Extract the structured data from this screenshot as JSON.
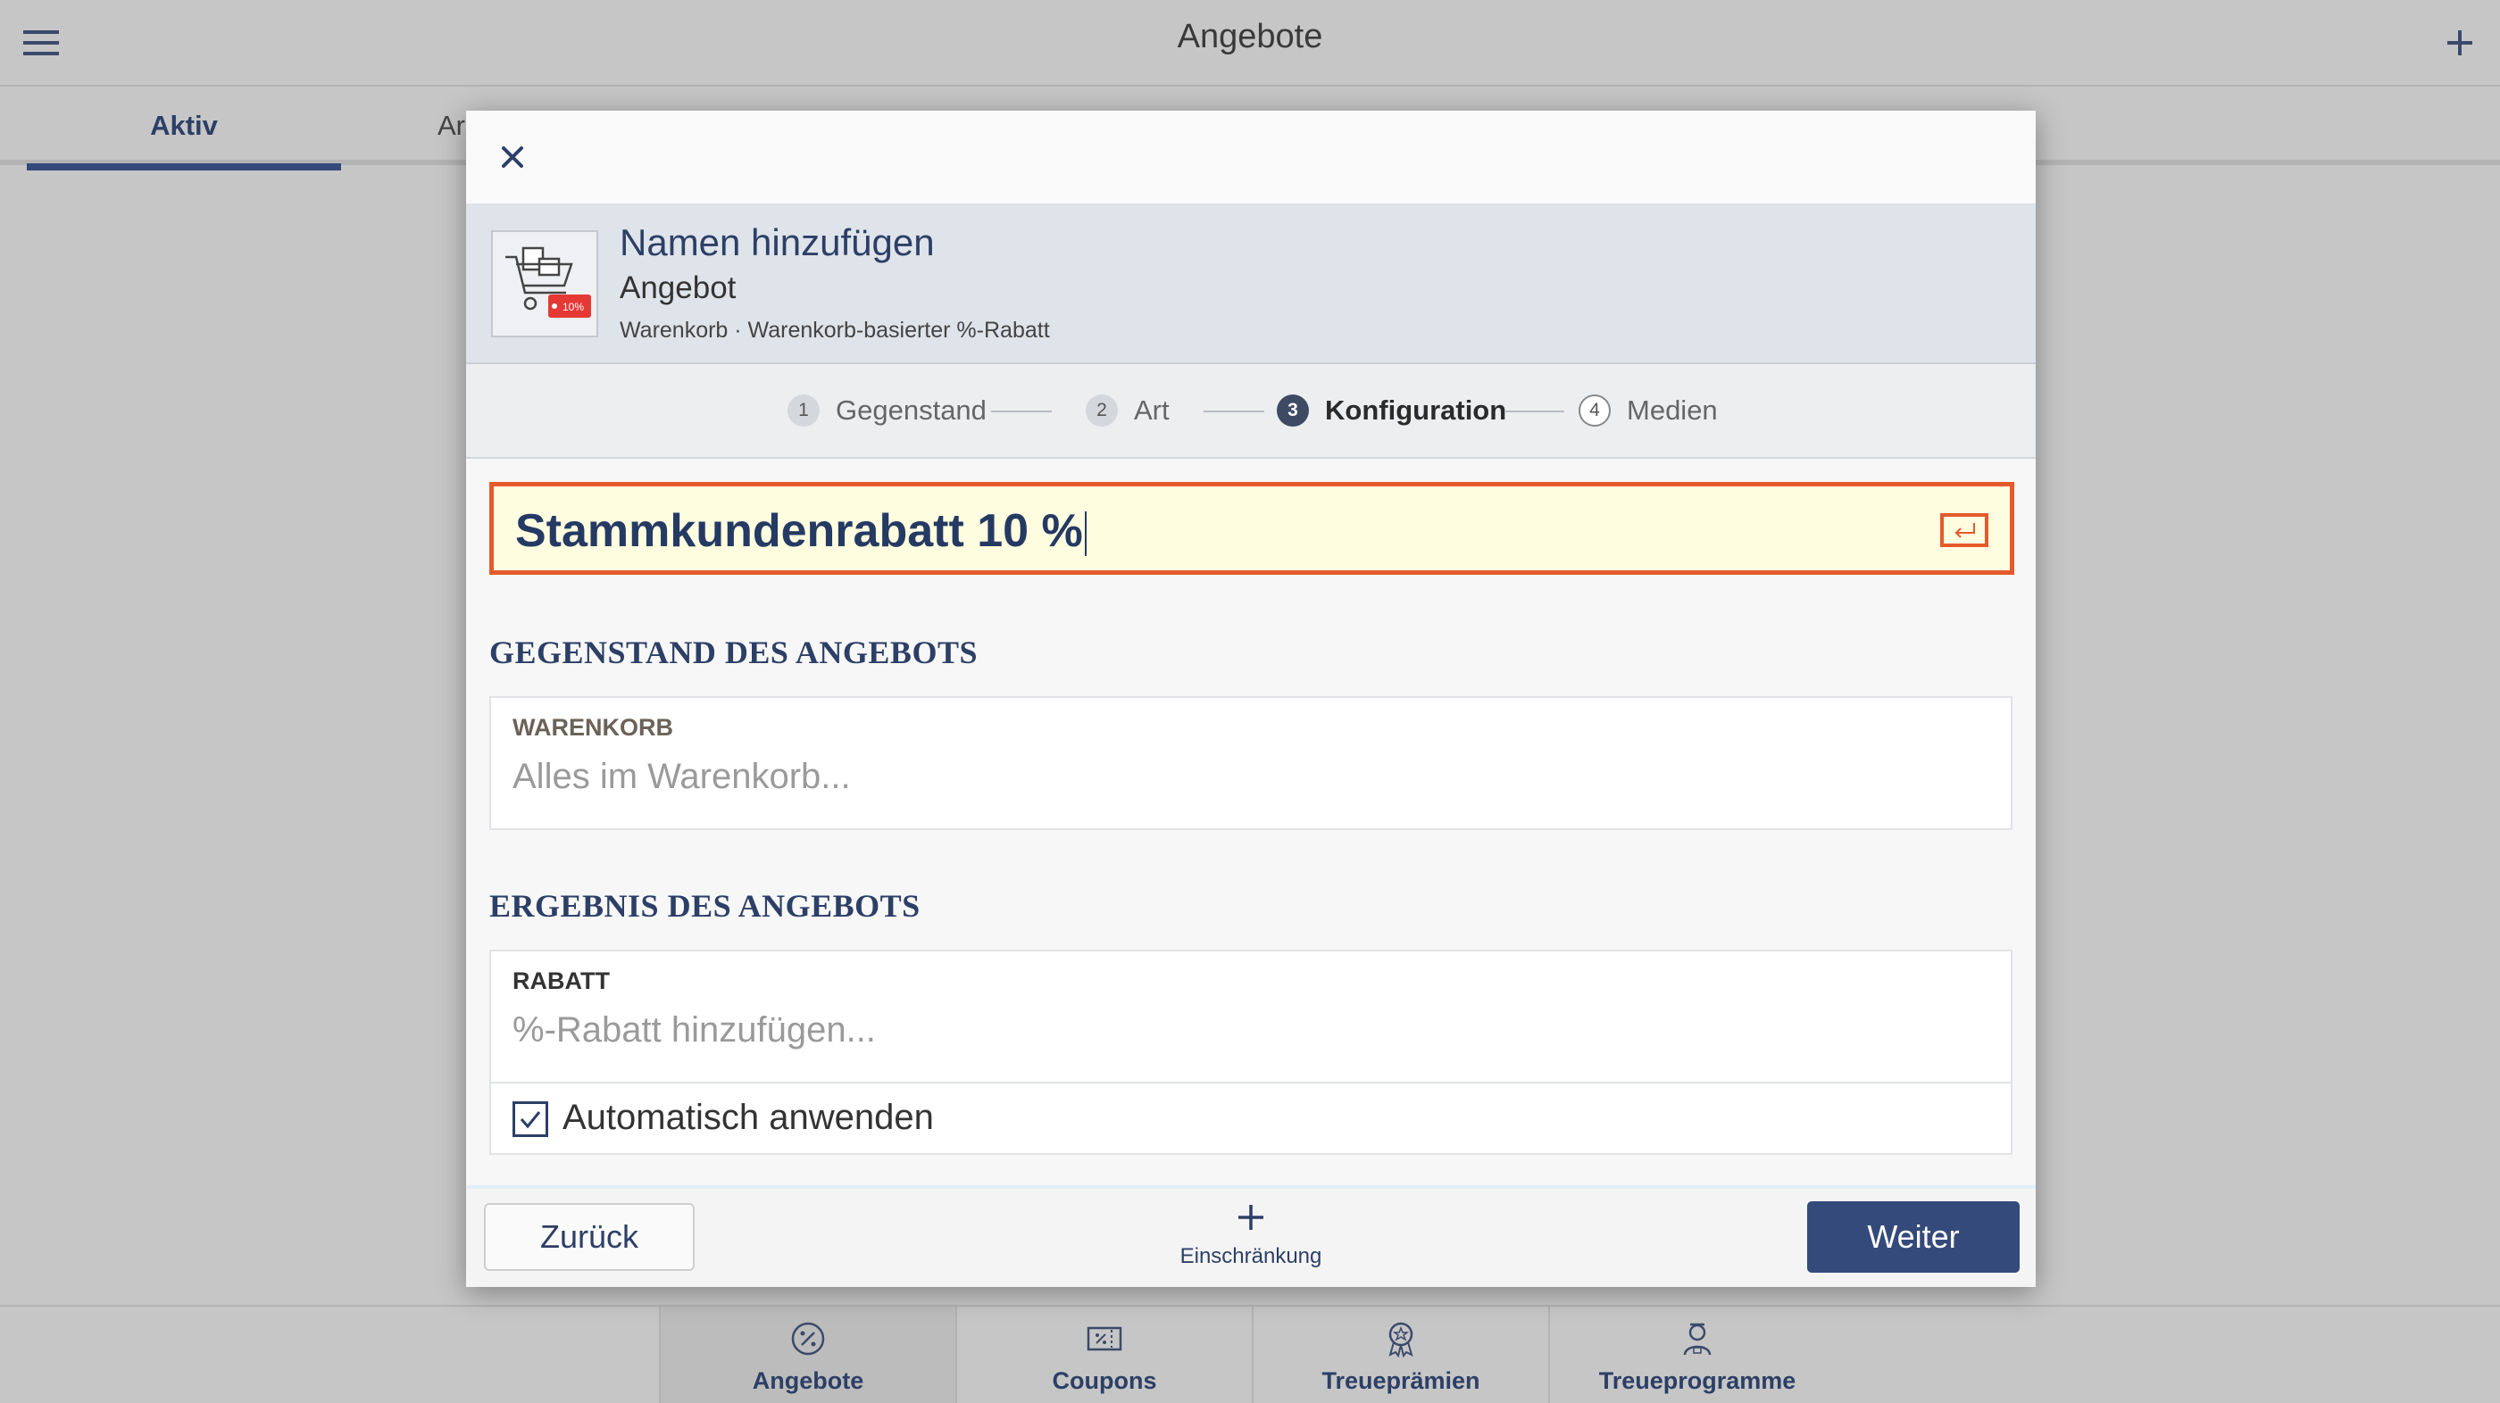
{
  "app": {
    "title": "Angebote"
  },
  "tabs": [
    {
      "label": "Aktiv"
    },
    {
      "label": "Ar"
    }
  ],
  "dialog": {
    "header": {
      "name": "Namen hinzufügen",
      "type": "Angebot",
      "meta": "Warenkorb · Warenkorb-basierter %-Rabatt",
      "thumb_badge": "10%"
    },
    "steps": [
      {
        "num": "1",
        "label": "Gegenstand",
        "state": "done"
      },
      {
        "num": "2",
        "label": "Art",
        "state": "done"
      },
      {
        "num": "3",
        "label": "Konfiguration",
        "state": "current"
      },
      {
        "num": "4",
        "label": "Medien",
        "state": "todo"
      }
    ],
    "name_input": {
      "value": "Stammkundenrabatt 10 %"
    },
    "section_subject": {
      "title": "GEGENSTAND DES ANGEBOTS",
      "field_label": "WARENKORB",
      "field_value": "Alles im Warenkorb..."
    },
    "section_result": {
      "title": "ERGEBNIS DES ANGEBOTS",
      "field_label": "RABATT",
      "field_value": "%-Rabatt hinzufügen...",
      "checkbox_label": "Automatisch anwenden",
      "checkbox_checked": true
    },
    "footer": {
      "back_label": "Zurück",
      "restriction_label": "Einschränkung",
      "next_label": "Weiter"
    }
  },
  "bottom_nav": [
    {
      "label": "Angebote",
      "icon": "percent-badge-icon",
      "active": true
    },
    {
      "label": "Coupons",
      "icon": "coupon-icon",
      "active": false
    },
    {
      "label": "Treueprämien",
      "icon": "award-icon",
      "active": false
    },
    {
      "label": "Treueprogramme",
      "icon": "person-badge-icon",
      "active": false
    }
  ],
  "colors": {
    "accent": "#344a7a",
    "highlight_border": "#e55a2b",
    "input_bg": "#fffde0"
  }
}
